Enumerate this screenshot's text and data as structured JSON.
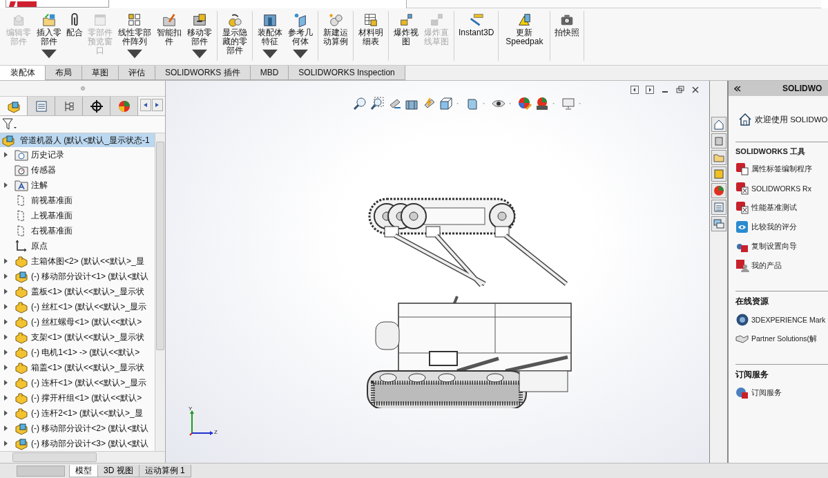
{
  "toolbar": {
    "groups": [
      [
        {
          "label": "编辑零部件",
          "disabled": true,
          "dropdown": false
        },
        {
          "label": "插入零部件",
          "disabled": false,
          "dropdown": true
        },
        {
          "label": "配合",
          "disabled": false,
          "dropdown": false
        },
        {
          "label": "零部件预览窗口",
          "disabled": true,
          "dropdown": false
        },
        {
          "label": "线性零部件阵列",
          "disabled": false,
          "dropdown": true
        },
        {
          "label": "智能扣件",
          "disabled": false,
          "dropdown": false
        },
        {
          "label": "移动零部件",
          "disabled": false,
          "dropdown": true
        }
      ],
      [
        {
          "label": "显示隐藏的零部件",
          "disabled": false,
          "dropdown": false
        }
      ],
      [
        {
          "label": "装配体特征",
          "disabled": false,
          "dropdown": true
        },
        {
          "label": "参考几何体",
          "disabled": false,
          "dropdown": true
        }
      ],
      [
        {
          "label": "新建运动算例",
          "disabled": false,
          "dropdown": false
        }
      ],
      [
        {
          "label": "材料明细表",
          "disabled": false,
          "dropdown": false
        }
      ],
      [
        {
          "label": "爆炸视图",
          "disabled": false,
          "dropdown": false
        },
        {
          "label": "爆炸直线草图",
          "disabled": true,
          "dropdown": false
        }
      ],
      [
        {
          "label": "Instant3D",
          "disabled": false,
          "dropdown": false
        }
      ],
      [
        {
          "label": "更新 Speedpak",
          "disabled": false,
          "dropdown": false
        }
      ],
      [
        {
          "label": "拍快照",
          "disabled": false,
          "dropdown": false
        }
      ]
    ]
  },
  "tabs": [
    {
      "label": "装配体",
      "selected": true
    },
    {
      "label": "布局",
      "selected": false
    },
    {
      "label": "草图",
      "selected": false
    },
    {
      "label": "评估",
      "selected": false
    },
    {
      "label": "SOLIDWORKS 插件",
      "selected": false
    },
    {
      "label": "MBD",
      "selected": false
    },
    {
      "label": "SOLIDWORKS Inspection",
      "selected": false
    }
  ],
  "feature_tree": {
    "root": "管道机器人 (默认<默认_显示状态-1",
    "items": [
      {
        "kind": "history",
        "label": "历史记录",
        "expandable": true
      },
      {
        "kind": "sensor",
        "label": "传感器",
        "expandable": false
      },
      {
        "kind": "annotation",
        "label": "注解",
        "expandable": true
      },
      {
        "kind": "plane",
        "label": "前视基准面",
        "expandable": false
      },
      {
        "kind": "plane",
        "label": "上视基准面",
        "expandable": false
      },
      {
        "kind": "plane",
        "label": "右视基准面",
        "expandable": false
      },
      {
        "kind": "origin",
        "label": "原点",
        "expandable": false
      },
      {
        "kind": "part",
        "label": "主箱体图<2> (默认<<默认>_显",
        "expandable": true
      },
      {
        "kind": "assembly",
        "label": "(-) 移动部分设计<1> (默认<默认",
        "expandable": true
      },
      {
        "kind": "part",
        "label": "盖板<1> (默认<<默认>_显示状",
        "expandable": true
      },
      {
        "kind": "part",
        "label": "(-) 丝杠<1> (默认<<默认>_显示",
        "expandable": true
      },
      {
        "kind": "part",
        "label": "(-) 丝杠螺母<1> (默认<<默认>",
        "expandable": true
      },
      {
        "kind": "part",
        "label": "支架<1> (默认<<默认>_显示状",
        "expandable": true
      },
      {
        "kind": "part",
        "label": "(-) 电机1<1> -> (默认<<默认>",
        "expandable": true
      },
      {
        "kind": "part",
        "label": "箱盖<1> (默认<<默认>_显示状",
        "expandable": true
      },
      {
        "kind": "part",
        "label": "(-) 连杆<1> (默认<<默认>_显示",
        "expandable": true
      },
      {
        "kind": "part",
        "label": "(-) 撑开杆组<1> (默认<<默认>",
        "expandable": true
      },
      {
        "kind": "part",
        "label": "(-) 连杆2<1> (默认<<默认>_显",
        "expandable": true
      },
      {
        "kind": "assembly",
        "label": "(-) 移动部分设计<2> (默认<默认",
        "expandable": true
      },
      {
        "kind": "assembly",
        "label": "(-) 移动部分设计<3> (默认<默认",
        "expandable": true
      }
    ]
  },
  "bottom_tabs": [
    {
      "label": "模型",
      "selected": true
    },
    {
      "label": "3D 视图",
      "selected": false
    },
    {
      "label": "运动算例 1",
      "selected": false
    }
  ],
  "viewport": {
    "axes": [
      {
        "label": "Y"
      },
      {
        "label": "Z"
      }
    ]
  },
  "task_pane": {
    "title": "SOLIDWO",
    "welcome": "欢迎使用  SOLIDWO",
    "sections": [
      {
        "title": "SOLIDWORKS 工具",
        "items": [
          {
            "label": "属性标签编制程序"
          },
          {
            "label": "SOLIDWORKS Rx"
          },
          {
            "label": "性能基准测试"
          },
          {
            "label": "比较我的评分"
          },
          {
            "label": "复制设置向导"
          },
          {
            "label": "我的产品"
          }
        ]
      },
      {
        "title": "在线资源",
        "items": [
          {
            "label": "3DEXPERIENCE Mark"
          },
          {
            "label": "Partner Solutions(解"
          }
        ]
      },
      {
        "title": "订阅服务",
        "items": [
          {
            "label": "订阅服务"
          }
        ]
      }
    ]
  }
}
